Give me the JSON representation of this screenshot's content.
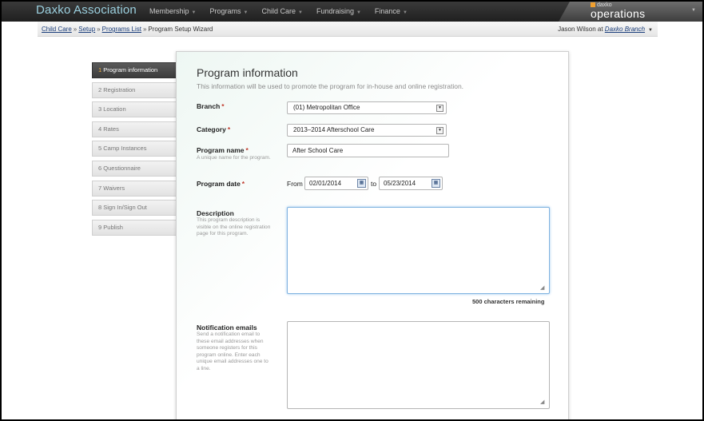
{
  "header": {
    "brand": "Daxko Association",
    "nav": [
      {
        "label": "Membership"
      },
      {
        "label": "Programs"
      },
      {
        "label": "Child Care"
      },
      {
        "label": "Fundraising"
      },
      {
        "label": "Finance"
      }
    ],
    "product_small": "daxko",
    "product_big": "operations"
  },
  "breadcrumb": {
    "items": [
      "Child Care",
      "Setup",
      "Programs List"
    ],
    "current": "Program Setup Wizard",
    "separator": "»"
  },
  "user": {
    "name": "Jason Wilson",
    "at": "at",
    "branch": "Daxko Branch"
  },
  "steps": [
    {
      "num": "1",
      "label": "Program information"
    },
    {
      "num": "2",
      "label": "Registration"
    },
    {
      "num": "3",
      "label": "Location"
    },
    {
      "num": "4",
      "label": "Rates"
    },
    {
      "num": "5",
      "label": "Camp Instances"
    },
    {
      "num": "6",
      "label": "Questionnaire"
    },
    {
      "num": "7",
      "label": "Waivers"
    },
    {
      "num": "8",
      "label": "Sign In/Sign Out"
    },
    {
      "num": "9",
      "label": "Publish"
    }
  ],
  "form": {
    "title": "Program information",
    "subtitle": "This information will be used to promote the program for in-house and online registration.",
    "branch": {
      "label": "Branch",
      "value": "(01) Metropolitan Office"
    },
    "category": {
      "label": "Category",
      "value": "2013–2014 Afterschool Care"
    },
    "program_name": {
      "label": "Program name",
      "hint": "A unique name for the program.",
      "value": "After School Care"
    },
    "program_date": {
      "label": "Program date",
      "from_label": "From",
      "from": "02/01/2014",
      "to_label": "to",
      "to": "05/23/2014"
    },
    "description": {
      "label": "Description",
      "hint": "This program description is visible on the online registration page for this program.",
      "remaining": "500 characters remaining"
    },
    "notification": {
      "label": "Notification emails",
      "hint": "Send a notification email to these email addresses when someone registers for this program online. Enter each unique email addresses one to a line."
    },
    "required_mark": "*"
  }
}
